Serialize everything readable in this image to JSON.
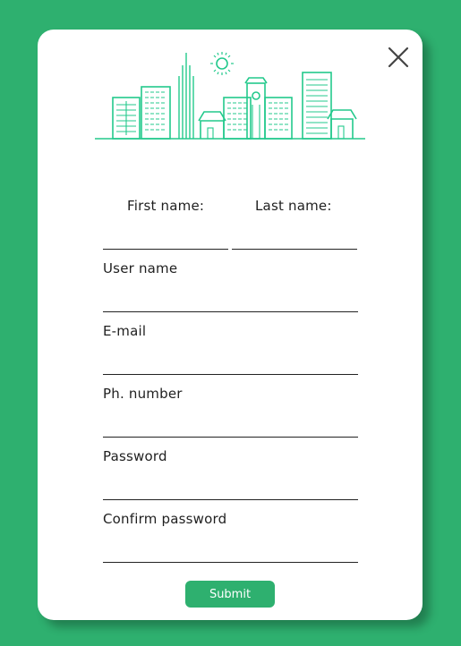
{
  "colors": {
    "background": "#2eb06f",
    "accent": "#23c98c",
    "card": "#ffffff",
    "submit": "#2eb06f"
  },
  "header": {
    "close_icon": "close-icon",
    "illustration": "city-skyline-illustration"
  },
  "form": {
    "first_name_label": "First name:",
    "last_name_label": "Last name:",
    "first_name_value": "",
    "last_name_value": "",
    "username_label": "User name",
    "username_value": "",
    "email_label": "E-mail",
    "email_value": "",
    "phone_label": "Ph. number",
    "phone_value": "",
    "password_label": "Password",
    "password_value": "",
    "confirm_password_label": "Confirm password",
    "confirm_password_value": "",
    "submit_label": "Submit"
  }
}
